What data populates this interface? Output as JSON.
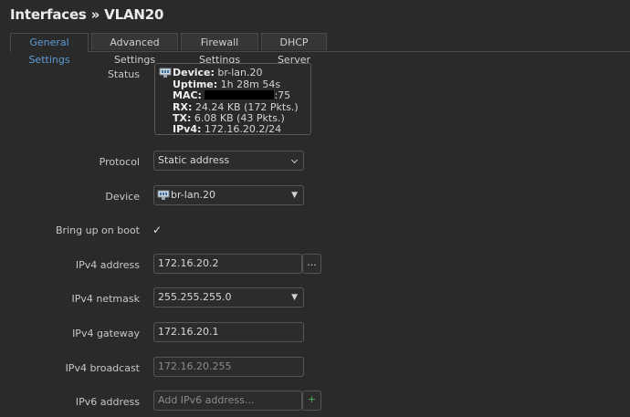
{
  "header": {
    "title": "Interfaces » VLAN20"
  },
  "tabs": [
    {
      "label": "General Settings"
    },
    {
      "label": "Advanced Settings"
    },
    {
      "label": "Firewall Settings"
    },
    {
      "label": "DHCP Server"
    }
  ],
  "status": {
    "label": "Status",
    "device_key": "Device:",
    "device_value": "br-lan.20",
    "uptime_key": "Uptime:",
    "uptime_value": "1h 28m 54s",
    "mac_key": "MAC:",
    "mac_suffix": ":75",
    "rx_key": "RX:",
    "rx_value": "24.24 KB (172 Pkts.)",
    "tx_key": "TX:",
    "tx_value": "6.08 KB (43 Pkts.)",
    "ipv4_key": "IPv4:",
    "ipv4_value": "172.16.20.2/24"
  },
  "protocol": {
    "label": "Protocol",
    "value": "Static address"
  },
  "device": {
    "label": "Device",
    "value": "br-lan.20"
  },
  "boot": {
    "label": "Bring up on boot",
    "checked_glyph": "✓"
  },
  "ipv4_address": {
    "label": "IPv4 address",
    "value": "172.16.20.2",
    "addon": "..."
  },
  "ipv4_netmask": {
    "label": "IPv4 netmask",
    "value": "255.255.255.0"
  },
  "ipv4_gateway": {
    "label": "IPv4 gateway",
    "value": "172.16.20.1"
  },
  "ipv4_broadcast": {
    "label": "IPv4 broadcast",
    "placeholder": "172.16.20.255"
  },
  "ipv6_address": {
    "label": "IPv6 address",
    "placeholder": "Add IPv6 address...",
    "addon": "+"
  },
  "colors": {
    "accent": "#5d9bd6",
    "add": "#4caf50"
  }
}
